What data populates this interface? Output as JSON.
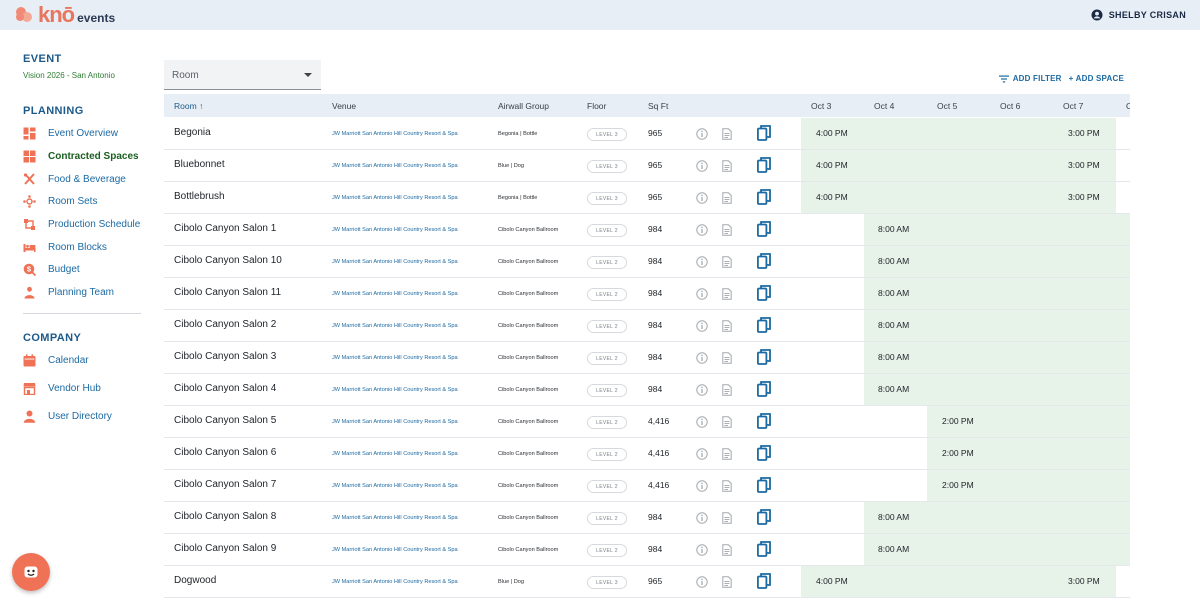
{
  "app": {
    "brand": "knō",
    "brand_suffix": "events",
    "user_name": "SHELBY CRISAN"
  },
  "colors": {
    "accent": "#1c6aa3",
    "brand": "#f07256",
    "active": "#1b5e20",
    "band": "#e7f2e8",
    "header_bg": "#e8eef6"
  },
  "sidebar": {
    "event_title": "EVENT",
    "event_name": "Vision 2026 - San Antonio",
    "planning_title": "PLANNING",
    "planning_items": [
      {
        "label": "Event Overview",
        "icon": "dashboard-icon"
      },
      {
        "label": "Contracted Spaces",
        "icon": "grid-icon",
        "active": true
      },
      {
        "label": "Food & Beverage",
        "icon": "utensils-icon"
      },
      {
        "label": "Room Sets",
        "icon": "room-sets-icon"
      },
      {
        "label": "Production Schedule",
        "icon": "schedule-icon"
      },
      {
        "label": "Room Blocks",
        "icon": "bed-icon"
      },
      {
        "label": "Budget",
        "icon": "budget-icon"
      },
      {
        "label": "Planning Team",
        "icon": "team-icon"
      }
    ],
    "company_title": "COMPANY",
    "company_items": [
      {
        "label": "Calendar",
        "icon": "calendar-icon"
      },
      {
        "label": "Vendor Hub",
        "icon": "vendor-icon"
      },
      {
        "label": "User Directory",
        "icon": "user-icon"
      }
    ]
  },
  "toolbar": {
    "room_select_value": "Room",
    "add_filter": "ADD FILTER",
    "add_space": "+ ADD SPACE"
  },
  "table": {
    "headers": {
      "room": "Room",
      "venue": "Venue",
      "airwall": "Airwall Group",
      "floor": "Floor",
      "sqft": "Sq Ft"
    },
    "dates": [
      "Oct 3",
      "Oct 4",
      "Oct 5",
      "Oct 6",
      "Oct 7",
      "O"
    ],
    "rows": [
      {
        "name": "Begonia",
        "venue": "JW Marriott San Antonio Hill Country Resort & Spa",
        "airwall": "Begonia | Bottle",
        "floor": "LEVEL 3",
        "sqft": "965",
        "start": "4:00 PM",
        "end": "3:00 PM"
      },
      {
        "name": "Bluebonnet",
        "venue": "JW Marriott San Antonio Hill Country Resort & Spa",
        "airwall": "Blue | Dog",
        "floor": "LEVEL 3",
        "sqft": "965",
        "start": "4:00 PM",
        "end": "3:00 PM"
      },
      {
        "name": "Bottlebrush",
        "venue": "JW Marriott San Antonio Hill Country Resort & Spa",
        "airwall": "Begonia | Bottle",
        "floor": "LEVEL 3",
        "sqft": "965",
        "start": "4:00 PM",
        "end": "3:00 PM"
      },
      {
        "name": "Cibolo Canyon Salon 1",
        "venue": "JW Marriott San Antonio Hill Country Resort & Spa",
        "airwall": "Cibolo Canyon Ballroom",
        "floor": "LEVEL 2",
        "sqft": "984",
        "start": "8:00 AM",
        "end": ""
      },
      {
        "name": "Cibolo Canyon Salon 10",
        "venue": "JW Marriott San Antonio Hill Country Resort & Spa",
        "airwall": "Cibolo Canyon Ballroom",
        "floor": "LEVEL 2",
        "sqft": "984",
        "start": "8:00 AM",
        "end": ""
      },
      {
        "name": "Cibolo Canyon Salon 11",
        "venue": "JW Marriott San Antonio Hill Country Resort & Spa",
        "airwall": "Cibolo Canyon Ballroom",
        "floor": "LEVEL 2",
        "sqft": "984",
        "start": "8:00 AM",
        "end": ""
      },
      {
        "name": "Cibolo Canyon Salon 2",
        "venue": "JW Marriott San Antonio Hill Country Resort & Spa",
        "airwall": "Cibolo Canyon Ballroom",
        "floor": "LEVEL 2",
        "sqft": "984",
        "start": "8:00 AM",
        "end": ""
      },
      {
        "name": "Cibolo Canyon Salon 3",
        "venue": "JW Marriott San Antonio Hill Country Resort & Spa",
        "airwall": "Cibolo Canyon Ballroom",
        "floor": "LEVEL 2",
        "sqft": "984",
        "start": "8:00 AM",
        "end": ""
      },
      {
        "name": "Cibolo Canyon Salon 4",
        "venue": "JW Marriott San Antonio Hill Country Resort & Spa",
        "airwall": "Cibolo Canyon Ballroom",
        "floor": "LEVEL 2",
        "sqft": "984",
        "start": "8:00 AM",
        "end": ""
      },
      {
        "name": "Cibolo Canyon Salon 5",
        "venue": "JW Marriott San Antonio Hill Country Resort & Spa",
        "airwall": "Cibolo Canyon Ballroom",
        "floor": "LEVEL 2",
        "sqft": "4,416",
        "start": "2:00 PM",
        "end": ""
      },
      {
        "name": "Cibolo Canyon Salon 6",
        "venue": "JW Marriott San Antonio Hill Country Resort & Spa",
        "airwall": "Cibolo Canyon Ballroom",
        "floor": "LEVEL 2",
        "sqft": "4,416",
        "start": "2:00 PM",
        "end": ""
      },
      {
        "name": "Cibolo Canyon Salon 7",
        "venue": "JW Marriott San Antonio Hill Country Resort & Spa",
        "airwall": "Cibolo Canyon Ballroom",
        "floor": "LEVEL 2",
        "sqft": "4,416",
        "start": "2:00 PM",
        "end": ""
      },
      {
        "name": "Cibolo Canyon Salon 8",
        "venue": "JW Marriott San Antonio Hill Country Resort & Spa",
        "airwall": "Cibolo Canyon Ballroom",
        "floor": "LEVEL 2",
        "sqft": "984",
        "start": "8:00 AM",
        "end": ""
      },
      {
        "name": "Cibolo Canyon Salon 9",
        "venue": "JW Marriott San Antonio Hill Country Resort & Spa",
        "airwall": "Cibolo Canyon Ballroom",
        "floor": "LEVEL 2",
        "sqft": "984",
        "start": "8:00 AM",
        "end": ""
      },
      {
        "name": "Dogwood",
        "venue": "JW Marriott San Antonio Hill Country Resort & Spa",
        "airwall": "Blue | Dog",
        "floor": "LEVEL 3",
        "sqft": "965",
        "start": "4:00 PM",
        "end": "3:00 PM"
      }
    ]
  }
}
